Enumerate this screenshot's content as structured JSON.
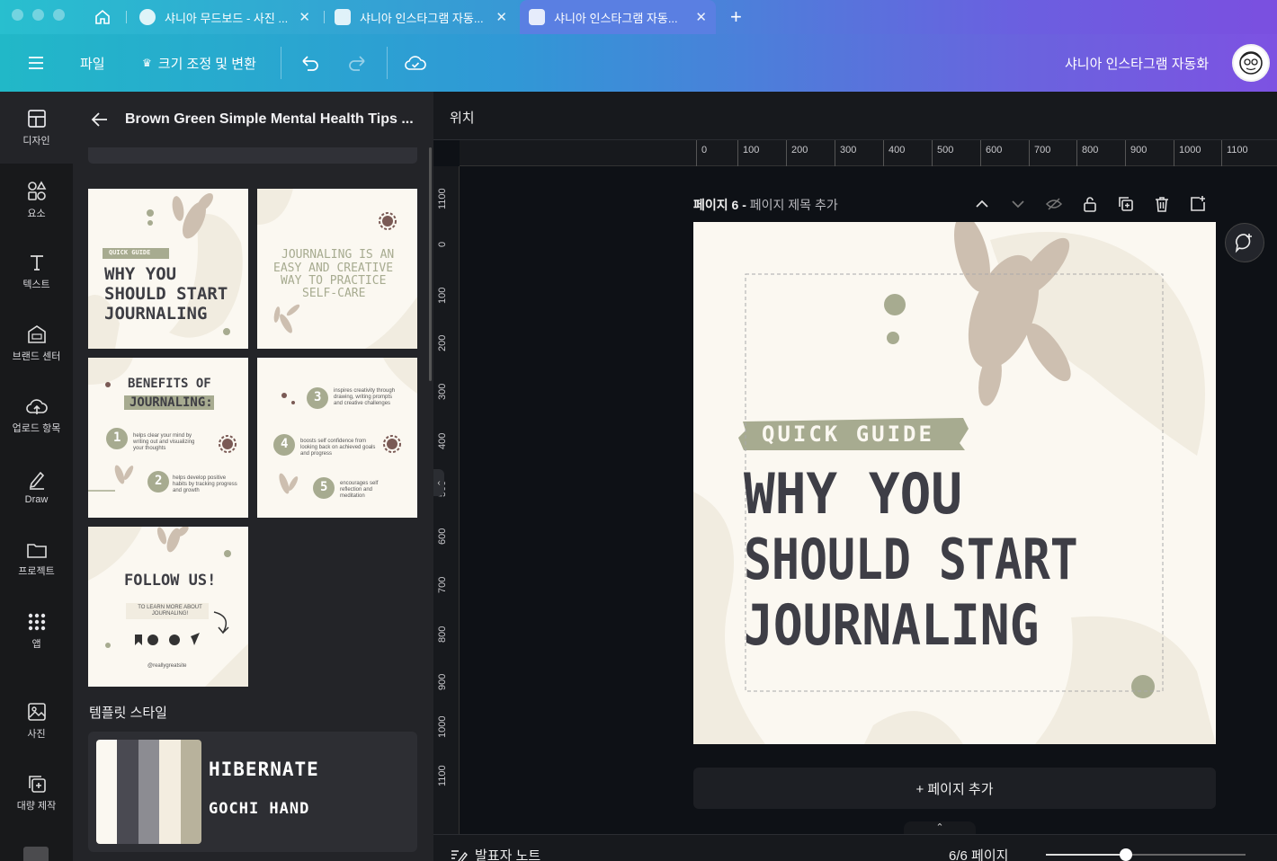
{
  "tabs": [
    {
      "title": "샤니아 무드보드 - 사진 ...",
      "active": false
    },
    {
      "title": "샤니아 인스타그램 자동...",
      "active": false
    },
    {
      "title": "샤니아 인스타그램 자동...",
      "active": true
    }
  ],
  "toolbar": {
    "file_label": "파일",
    "resize_label": "크기 조정 및 변환",
    "project_name": "샤니아 인스타그램 자동화"
  },
  "rail": [
    {
      "label": "디자인",
      "icon": "layout-icon"
    },
    {
      "label": "요소",
      "icon": "shapes-icon"
    },
    {
      "label": "텍스트",
      "icon": "text-icon"
    },
    {
      "label": "브랜드 센터",
      "icon": "brand-icon"
    },
    {
      "label": "업로드 항목",
      "icon": "cloud-upload-icon"
    },
    {
      "label": "Draw",
      "icon": "pen-icon"
    },
    {
      "label": "프로젝트",
      "icon": "folder-icon"
    },
    {
      "label": "앱",
      "icon": "apps-grid-icon"
    },
    {
      "label": "사진",
      "icon": "image-icon"
    },
    {
      "label": "대량 제작",
      "icon": "bulk-create-icon"
    }
  ],
  "panel": {
    "title": "Brown Green Simple Mental Health Tips ...",
    "cards": {
      "c1": {
        "tag": "QUICK GUIDE",
        "line1": "WHY YOU",
        "line2": "SHOULD START",
        "line3": "JOURNALING"
      },
      "c2": {
        "line1": "JOURNALING IS AN",
        "line2": "EASY AND CREATIVE",
        "line3": "WAY TO PRACTICE",
        "line4": "SELF-CARE"
      },
      "c3": {
        "line1": "BENEFITS OF",
        "line2": "JOURNALING:",
        "n1": "1",
        "t1": "helps clear your mind by writing out and visualizing your thoughts",
        "n2": "2",
        "t2": "helps develop positive habits by tracking progress and growth"
      },
      "c4": {
        "n3": "3",
        "t3": "inspires creativity through drawing, writing prompts and creative challenges",
        "n4": "4",
        "t4": "boosts self confidence from looking back on achieved goals and progress",
        "n5": "5",
        "t5": "encourages self reflection and meditation"
      },
      "c5": {
        "title": "FOLLOW US!",
        "sub": "TO LEARN MORE ABOUT JOURNALING!",
        "handle": "@reallygreatsite"
      }
    },
    "style_section": "템플릿 스타일",
    "style_font1": "HIBERNATE",
    "style_font2": "GOCHI HAND",
    "palette": [
      "#fbf8f1",
      "#4a4a52",
      "#8c8c92",
      "#f3ede0",
      "#b8b29c"
    ]
  },
  "workspace": {
    "position_label": "위치",
    "page_label": "페이지 6 - ",
    "page_sub": "페이지 제목 추가",
    "h_ticks": [
      "0",
      "100",
      "200",
      "300",
      "400",
      "500",
      "600",
      "700",
      "800",
      "900",
      "1000",
      "1100"
    ],
    "v_ticks": [
      "1100",
      "0",
      "100",
      "200",
      "300",
      "400",
      "500",
      "600",
      "700",
      "800",
      "900",
      "1000",
      "1100"
    ],
    "add_page": "+ 페이지 추가",
    "notes_label": "발표자 노트",
    "page_count": "6/6 페이지",
    "zoom_fraction": 0.4
  },
  "design": {
    "tag": "QUICK GUIDE",
    "line1": "WHY YOU",
    "line2": "SHOULD START",
    "line3": "JOURNALING"
  },
  "colors": {
    "accent_green": "#a7ab90",
    "leaf": "#cdbfb0",
    "dark_text": "#3e3e46",
    "cream": "#fbf8f1"
  }
}
